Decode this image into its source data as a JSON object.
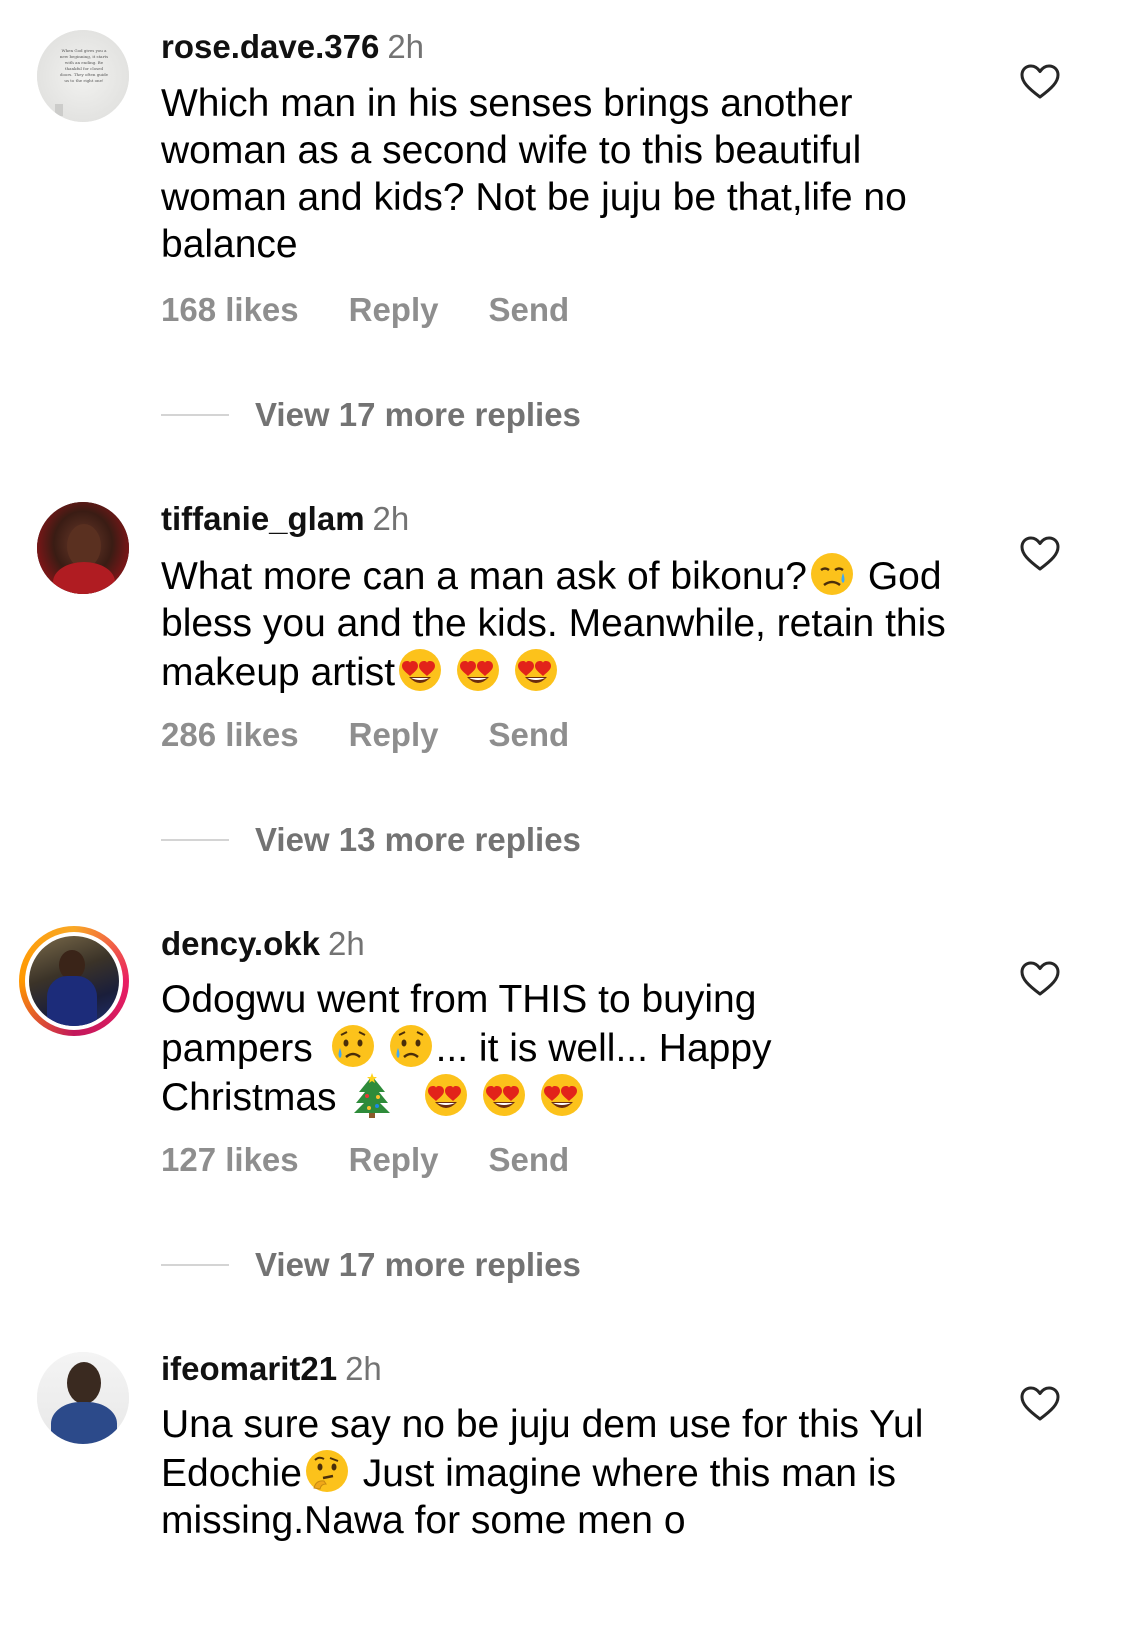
{
  "comments": [
    {
      "username": "rose.dave.376",
      "time": "2h",
      "text": "Which man in his senses  brings another woman as a second wife to this beautiful woman and kids? Not be juju be that,life no balance",
      "likes": "168 likes",
      "reply": "Reply",
      "send": "Send",
      "view_replies": "View 17 more replies",
      "avatar_quote": "When God gives you a new beginning, it starts with an ending. Be thankful for closed doors. They often guide us to the right one!"
    },
    {
      "username": "tiffanie_glam",
      "time": "2h",
      "text_parts": [
        "What more can a man ask of bikonu?",
        "God bless you and the kids. Meanwhile, retain this makeup artist"
      ],
      "likes": "286 likes",
      "reply": "Reply",
      "send": "Send",
      "view_replies": "View 13 more replies"
    },
    {
      "username": "dency.okk",
      "time": "2h",
      "text_parts": [
        "Odogwu went from THIS to buying pampers ",
        "... it is well... Happy Christmas "
      ],
      "likes": "127 likes",
      "reply": "Reply",
      "send": "Send",
      "view_replies": "View 17 more replies"
    },
    {
      "username": "ifeomarit21",
      "time": "2h",
      "text_parts": [
        "Una sure say no be juju dem use for this Yul Edochie",
        " Just imagine where this man is missing.Nawa for some men o"
      ]
    }
  ],
  "icons": {
    "like": "heart-outline-icon",
    "emoji_sad": "sad-relieved-face-emoji",
    "emoji_heart_eyes": "heart-eyes-emoji",
    "emoji_crying": "crying-face-emoji",
    "emoji_tree": "christmas-tree-emoji",
    "emoji_thinking": "thinking-face-emoji"
  },
  "colors": {
    "username": "#111111",
    "secondary_text": "#737373",
    "meta": "#8e8e8e",
    "divider": "#d4d4d4"
  }
}
